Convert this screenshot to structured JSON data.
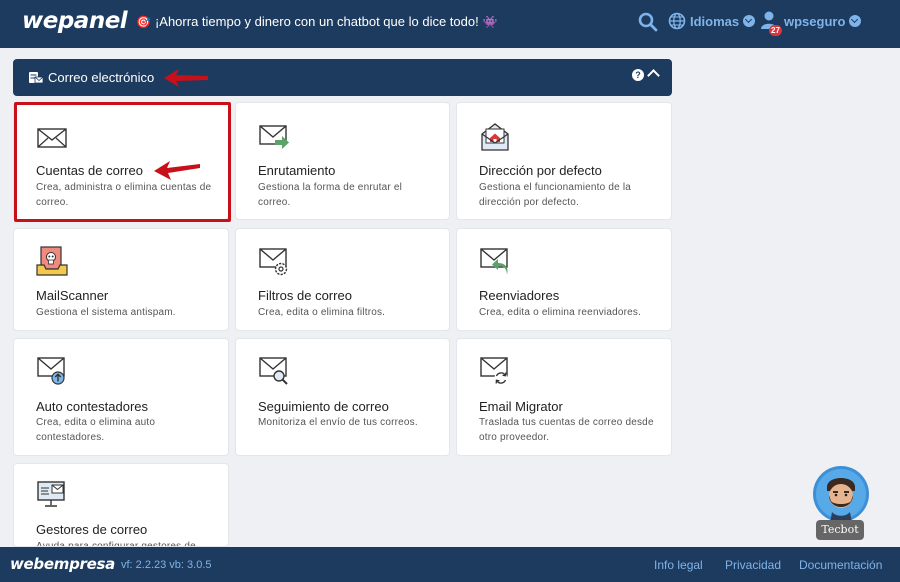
{
  "header": {
    "logo": "wepanel",
    "promo": "¡Ahorra tiempo y dinero con un chatbot que lo dice todo!",
    "languages_label": "Idiomas",
    "username": "wpseguro",
    "notifications": "27"
  },
  "section": {
    "title": "Correo electrónico",
    "help": "?"
  },
  "cards": [
    {
      "title": "Cuentas de correo",
      "desc": "Crea, administra o elimina cuentas de correo."
    },
    {
      "title": "Enrutamiento",
      "desc": "Gestiona la forma de enrutar el correo."
    },
    {
      "title": "Dirección por defecto",
      "desc": "Gestiona el funcionamiento de la dirección por defecto."
    },
    {
      "title": "MailScanner",
      "desc": "Gestiona el sistema antispam."
    },
    {
      "title": "Filtros de correo",
      "desc": "Crea, edita o elimina filtros."
    },
    {
      "title": "Reenviadores",
      "desc": "Crea, edita o elimina reenviadores."
    },
    {
      "title": "Auto contestadores",
      "desc": "Crea, edita o elimina auto contestadores."
    },
    {
      "title": "Seguimiento de correo",
      "desc": "Monitoriza el envío de tus correos."
    },
    {
      "title": "Email Migrator",
      "desc": "Traslada tus cuentas de correo desde otro proveedor."
    },
    {
      "title": "Gestores de correo",
      "desc": "Ayuda para configurar gestores de correo."
    }
  ],
  "footer": {
    "logo": "webempresa",
    "version": "vf: 2.2.23 vb: 3.0.5",
    "links": [
      "Info legal",
      "Privacidad",
      "Documentación"
    ]
  },
  "chatbot": {
    "label": "Tecbot"
  },
  "colors": {
    "navy": "#1d3a5f",
    "accent": "#7fb4ea",
    "annotation": "#c8101a",
    "badge": "#d9363e"
  }
}
